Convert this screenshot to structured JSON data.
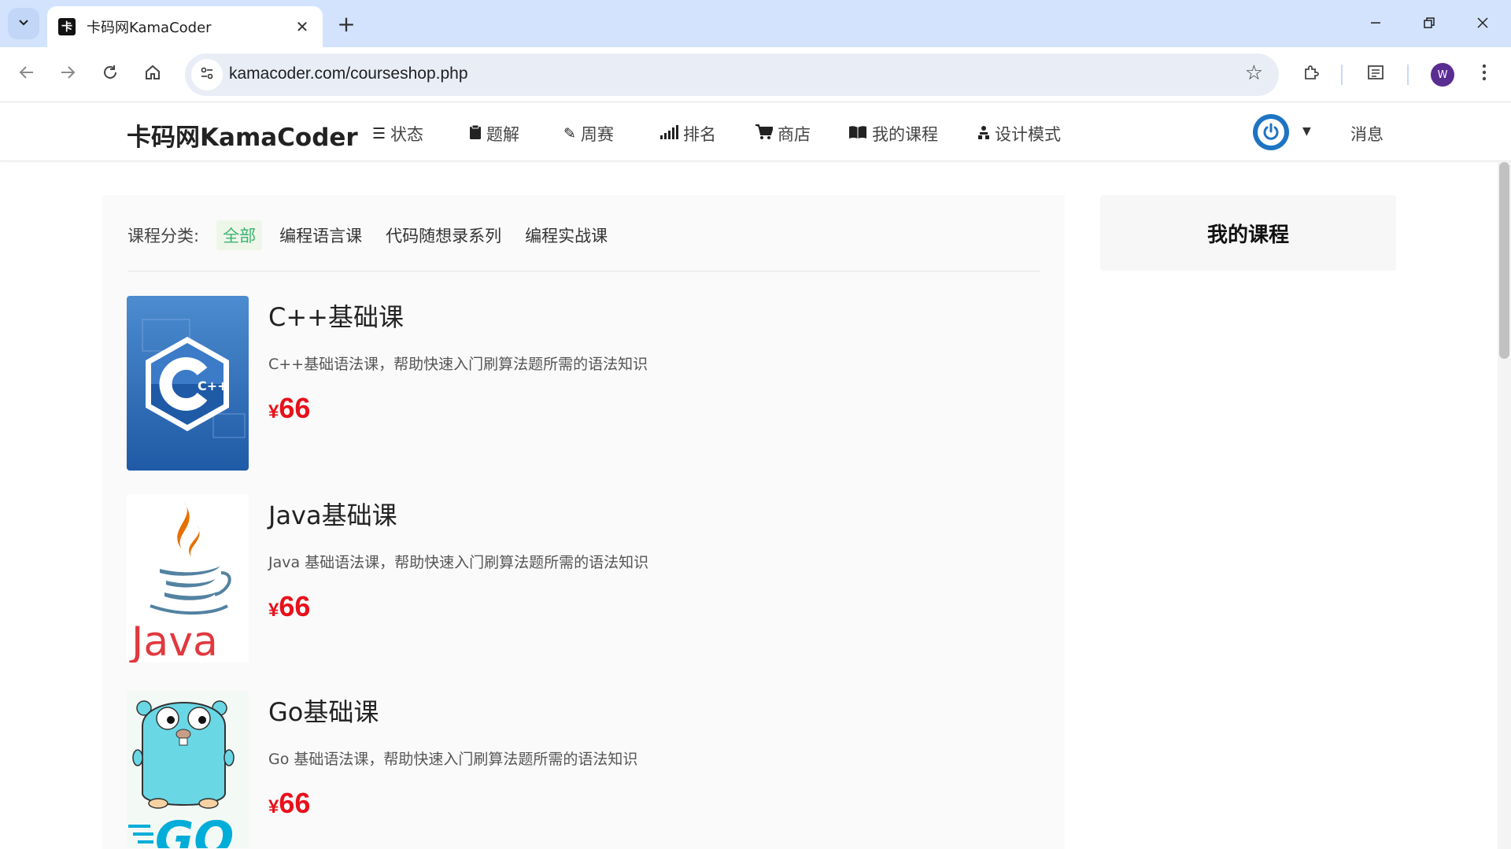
{
  "browser": {
    "tab_title": "卡码网KamaCoder",
    "tab_favicon": "卡",
    "url": "kamacoder.com/courseshop.php",
    "profile_initial": "W",
    "icons": {
      "tab_search": "chevron-down-icon",
      "back": "arrow-left-icon",
      "forward": "arrow-right-icon",
      "reload": "reload-icon",
      "home": "home-icon",
      "site_info": "tune-icon",
      "bookmark": "star-icon",
      "extensions": "puzzle-icon",
      "reading_list": "reading-list-icon",
      "menu": "kebab-icon"
    }
  },
  "site": {
    "brand": "卡码网KamaCoder",
    "nav": [
      {
        "icon": "list-icon",
        "label": "状态"
      },
      {
        "icon": "clipboard-icon",
        "label": "题解"
      },
      {
        "icon": "pencil-icon",
        "label": "周赛"
      },
      {
        "icon": "signal-icon",
        "label": "排名"
      },
      {
        "icon": "cart-icon",
        "label": "商店"
      },
      {
        "icon": "book-icon",
        "label": "我的课程"
      },
      {
        "icon": "sitemap-icon",
        "label": "设计模式"
      }
    ],
    "messages": "消息",
    "accent": "#1e74c3"
  },
  "filter": {
    "label": "课程分类:",
    "options": [
      "全部",
      "编程语言课",
      "代码随想录系列",
      "编程实战课"
    ],
    "active": "全部",
    "active_color": "#3cb371"
  },
  "courses": [
    {
      "title": "C++基础课",
      "desc": "C++基础语法课，帮助快速入门刷算法题所需的语法知识",
      "currency": "¥",
      "price": "66",
      "image_text": "C++"
    },
    {
      "title": "Java基础课",
      "desc": "Java 基础语法课，帮助快速入门刷算法题所需的语法知识",
      "currency": "¥",
      "price": "66",
      "image_text": "Java"
    },
    {
      "title": "Go基础课",
      "desc": "Go 基础语法课，帮助快速入门刷算法题所需的语法知识",
      "currency": "¥",
      "price": "66",
      "image_text": "GO"
    }
  ],
  "sidebar": {
    "title": "我的课程"
  },
  "price_color": "#e8101a"
}
